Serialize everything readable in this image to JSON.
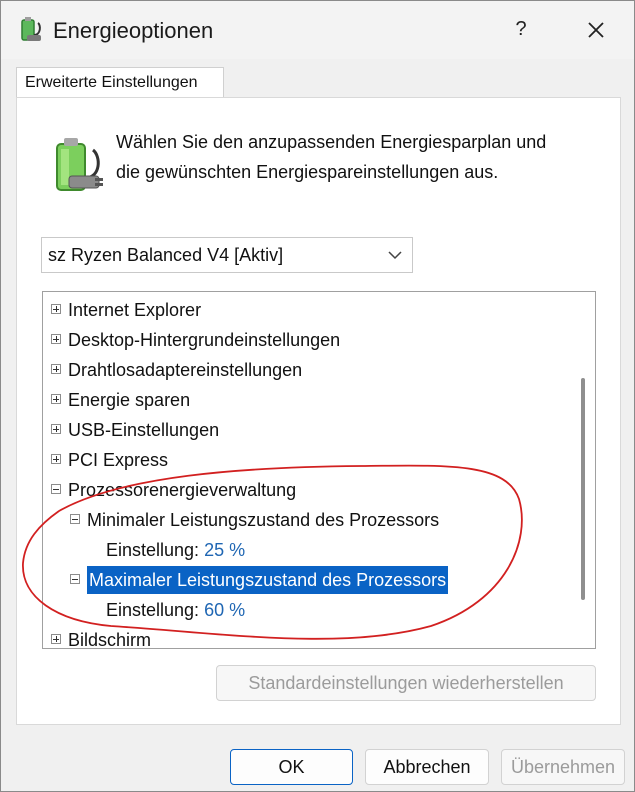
{
  "window": {
    "title": "Energieoptionen",
    "help_glyph": "?",
    "close_icon": "close-icon",
    "app_icon": "battery-plug-icon"
  },
  "tabs": [
    {
      "label": "Erweiterte Einstellungen",
      "active": true
    }
  ],
  "intro": {
    "line1": "Wählen Sie den anzupassenden Energiesparplan und",
    "line2": "die gewünschten Energiespareinstellungen aus."
  },
  "plan_select": {
    "value": "sz Ryzen Balanced V4 [Aktiv]"
  },
  "tree": {
    "items": [
      {
        "label": "Internet Explorer",
        "expanded": false
      },
      {
        "label": "Desktop-Hintergrundeinstellungen",
        "expanded": false
      },
      {
        "label": "Drahtlosadaptereinstellungen",
        "expanded": false
      },
      {
        "label": "Energie sparen",
        "expanded": false
      },
      {
        "label": "USB-Einstellungen",
        "expanded": false
      },
      {
        "label": "PCI Express",
        "expanded": false
      },
      {
        "label": "Prozessorenergieverwaltung",
        "expanded": true
      },
      {
        "label": "Minimaler Leistungszustand des Prozessors",
        "expanded": true
      },
      {
        "setting_label": "Einstellung:",
        "setting_value": "25 %"
      },
      {
        "label": "Maximaler Leistungszustand des Prozessors",
        "expanded": true,
        "selected": true
      },
      {
        "setting_label": "Einstellung:",
        "setting_value": "60 %"
      },
      {
        "label": "Bildschirm",
        "expanded": false
      }
    ]
  },
  "restore_button": {
    "label": "Standardeinstellungen wiederherstellen",
    "enabled": false
  },
  "buttons": {
    "ok": "OK",
    "cancel": "Abbrechen",
    "apply": "Übernehmen"
  },
  "colors": {
    "selection": "#0a63c5",
    "value_text": "#1f66b3",
    "annotation": "#d22020"
  }
}
